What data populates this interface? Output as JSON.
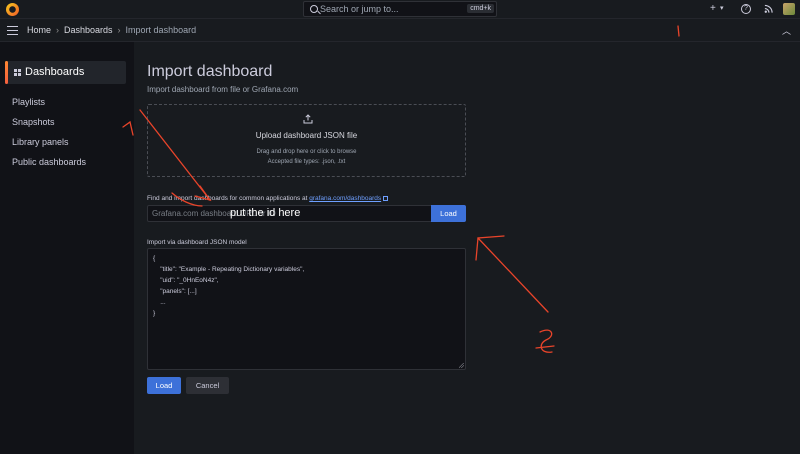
{
  "topbar": {
    "search_placeholder": "Search or jump to...",
    "shortcut": "cmd+k",
    "add_label": "+",
    "add_chevron": "▾"
  },
  "breadcrumb": {
    "items": [
      "Home",
      "Dashboards",
      "Import dashboard"
    ],
    "separator": "›"
  },
  "sidebar": {
    "active": "Dashboards",
    "items": [
      "Playlists",
      "Snapshots",
      "Library panels",
      "Public dashboards"
    ]
  },
  "main": {
    "title": "Import dashboard",
    "subtitle": "Import dashboard from file or Grafana.com",
    "upload": {
      "title": "Upload dashboard JSON file",
      "hint": "Drag and drop here or click to browse",
      "types": "Accepted file types: .json, .txt"
    },
    "find": {
      "label": "Find and import dashboards for common applications at",
      "link": "grafana.com/dashboards",
      "placeholder": "Grafana.com dashboard URL or ID",
      "load_label": "Load"
    },
    "json": {
      "label": "Import via dashboard JSON model",
      "lines": [
        "{",
        "    \"title\": \"Example - Repeating Dictionary variables\",",
        "    \"uid\": \"_0HnEoN4z\",",
        "    \"panels\": [...]",
        "    ...",
        "}"
      ]
    },
    "buttons": {
      "load": "Load",
      "cancel": "Cancel"
    }
  },
  "annotation": {
    "text": "put the id here",
    "color": "#e8442a"
  }
}
